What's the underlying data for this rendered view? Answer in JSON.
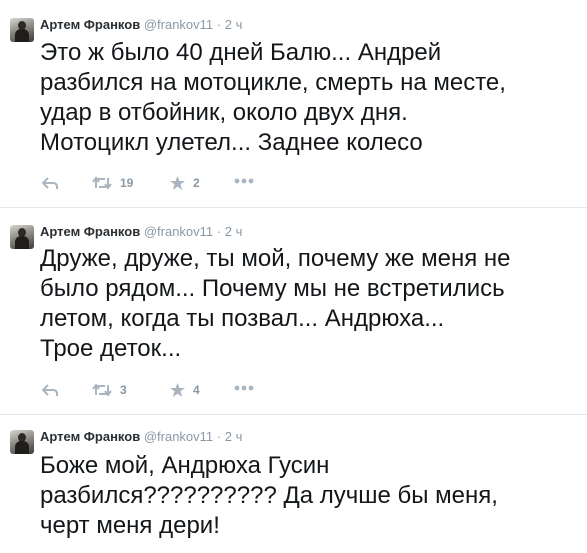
{
  "colors": {
    "text": "#14171a",
    "muted": "#8899a6",
    "divider": "#e1e8ed"
  },
  "tweets": [
    {
      "author": "Артем Франков",
      "handle": "@frankov11",
      "separator": "·",
      "time": "2 ч",
      "text": "Это ж было 40 дней Балю... Андрей\nразбился на мотоцикле, смерть на месте,\nудар в отбойник, около двух дня.\nМотоцикл улетел... Заднее колесо",
      "retweets": "19",
      "favorites": "2",
      "icons": [
        "reply-icon",
        "retweet-icon",
        "favorite-icon",
        "more-icon"
      ]
    },
    {
      "author": "Артем Франков",
      "handle": "@frankov11",
      "separator": "·",
      "time": "2 ч",
      "text": "Друже, друже, ты мой, почему же меня не\nбыло рядом... Почему мы не встретились\nлетом, когда ты позвал...  Андрюха...\nТрое деток...",
      "retweets": "3",
      "favorites": "4",
      "icons": [
        "reply-icon",
        "retweet-icon",
        "favorite-icon",
        "more-icon"
      ]
    },
    {
      "author": "Артем Франков",
      "handle": "@frankov11",
      "separator": "·",
      "time": "2 ч",
      "text": "Боже мой, Андрюха Гусин\nразбился?????????? Да лучше бы меня,\nчерт меня дери!"
    }
  ]
}
